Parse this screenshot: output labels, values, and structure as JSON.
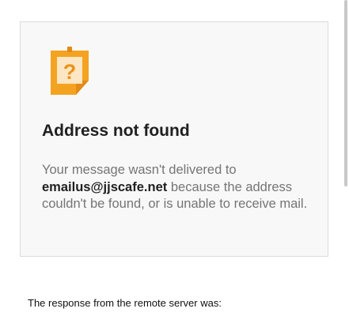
{
  "card": {
    "icon": "question-mark-sticky-note-icon",
    "icon_glyph": "?",
    "title": "Address not found",
    "message_before": "Your message wasn't delivered to",
    "email": "emailus@jjscafe.net",
    "message_after": "because the address couldn't be found, or is unable to receive mail."
  },
  "response_label": "The response from the remote server was:",
  "colors": {
    "icon_orange": "#f4a321",
    "icon_fold": "#e38a17",
    "title": "#202020",
    "message": "#757575",
    "card_background": "#f8f8f8"
  }
}
